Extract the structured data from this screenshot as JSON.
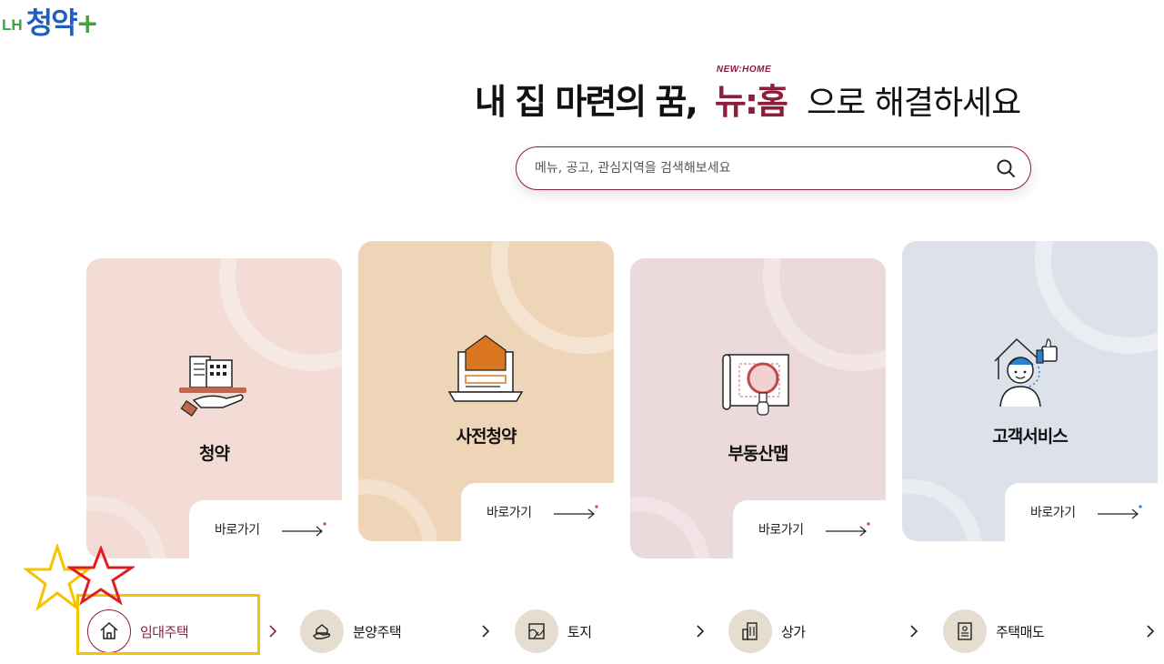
{
  "logo": {
    "lh": "LH",
    "name": "청약",
    "plus": "+"
  },
  "headline": {
    "part1": "내 집 마련의 꿈,",
    "brand_top": "NEW:HOME",
    "brand_main": "뉴:홈",
    "part2": "으로 해결하세요"
  },
  "search": {
    "placeholder": "메뉴, 공고, 관심지역을 검색해보세요"
  },
  "cards": [
    {
      "title": "청약",
      "go_label": "바로가기",
      "bg": "#f2dcd5",
      "accent": "#c0483c"
    },
    {
      "title": "사전청약",
      "go_label": "바로가기",
      "bg": "#efd5b8",
      "accent": "#c0483c"
    },
    {
      "title": "부동산맵",
      "go_label": "바로가기",
      "bg": "#ecd9db",
      "accent": "#c0483c"
    },
    {
      "title": "고객서비스",
      "go_label": "바로가기",
      "bg": "#dde2ea",
      "accent": "#2b7fd0"
    }
  ],
  "categories": [
    {
      "label": "임대주택",
      "icon": "house-icon",
      "active": true
    },
    {
      "label": "분양주택",
      "icon": "house-hand-icon",
      "active": false
    },
    {
      "label": "토지",
      "icon": "land-map-icon",
      "active": false
    },
    {
      "label": "상가",
      "icon": "building-icon",
      "active": false
    },
    {
      "label": "주택매도",
      "icon": "document-icon",
      "active": false
    }
  ],
  "colors": {
    "brand": "#8c1d3d",
    "highlight": "#f5c400",
    "star_red": "#e02020"
  }
}
